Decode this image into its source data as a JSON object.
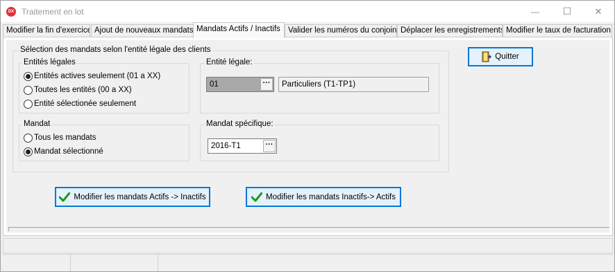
{
  "window": {
    "title": "Traitement en lot",
    "icon_label": "DX",
    "minimize_glyph": "—",
    "maximize_glyph": "☐",
    "close_glyph": "✕"
  },
  "tabs": [
    {
      "label": "Modifier la fin d'exercice"
    },
    {
      "label": "Ajout de nouveaux mandats"
    },
    {
      "label": "Mandats Actifs / Inactifs"
    },
    {
      "label": "Valider les numéros du conjoint"
    },
    {
      "label": "Déplacer les enregistrements"
    },
    {
      "label": "Modifier le taux de facturation"
    }
  ],
  "active_tab": "Mandats Actifs / Inactifs",
  "selection_group": {
    "title": "Sélection des mandats selon l'entité légale des clients",
    "entities_group": {
      "title": "Entités légales",
      "options": [
        {
          "label": "Entités actives seulement (01 a XX)",
          "checked": true
        },
        {
          "label": "Toutes les entités (00 a XX)",
          "checked": false
        },
        {
          "label": "Entité sélectionée seulement",
          "checked": false
        }
      ]
    },
    "entity_legale": {
      "title": "Entité légale:",
      "code": "01",
      "description": "Particuliers (T1-TP1)",
      "dots": "···"
    },
    "mandat_group": {
      "title": "Mandat",
      "options": [
        {
          "label": "Tous les mandats",
          "checked": false
        },
        {
          "label": "Mandat sélectionné",
          "checked": true
        }
      ]
    },
    "mandat_specifique": {
      "title": "Mandat spécifique:",
      "value": "2016-T1",
      "dots": "···"
    }
  },
  "buttons": {
    "quit": "Quitter",
    "to_inactive": "Modifier les mandats Actifs -> Inactifs",
    "to_active": "Modifier les mandats Inactifs-> Actifs"
  },
  "colors": {
    "accent": "#0078d7",
    "check_green": "#1a9a1a"
  }
}
